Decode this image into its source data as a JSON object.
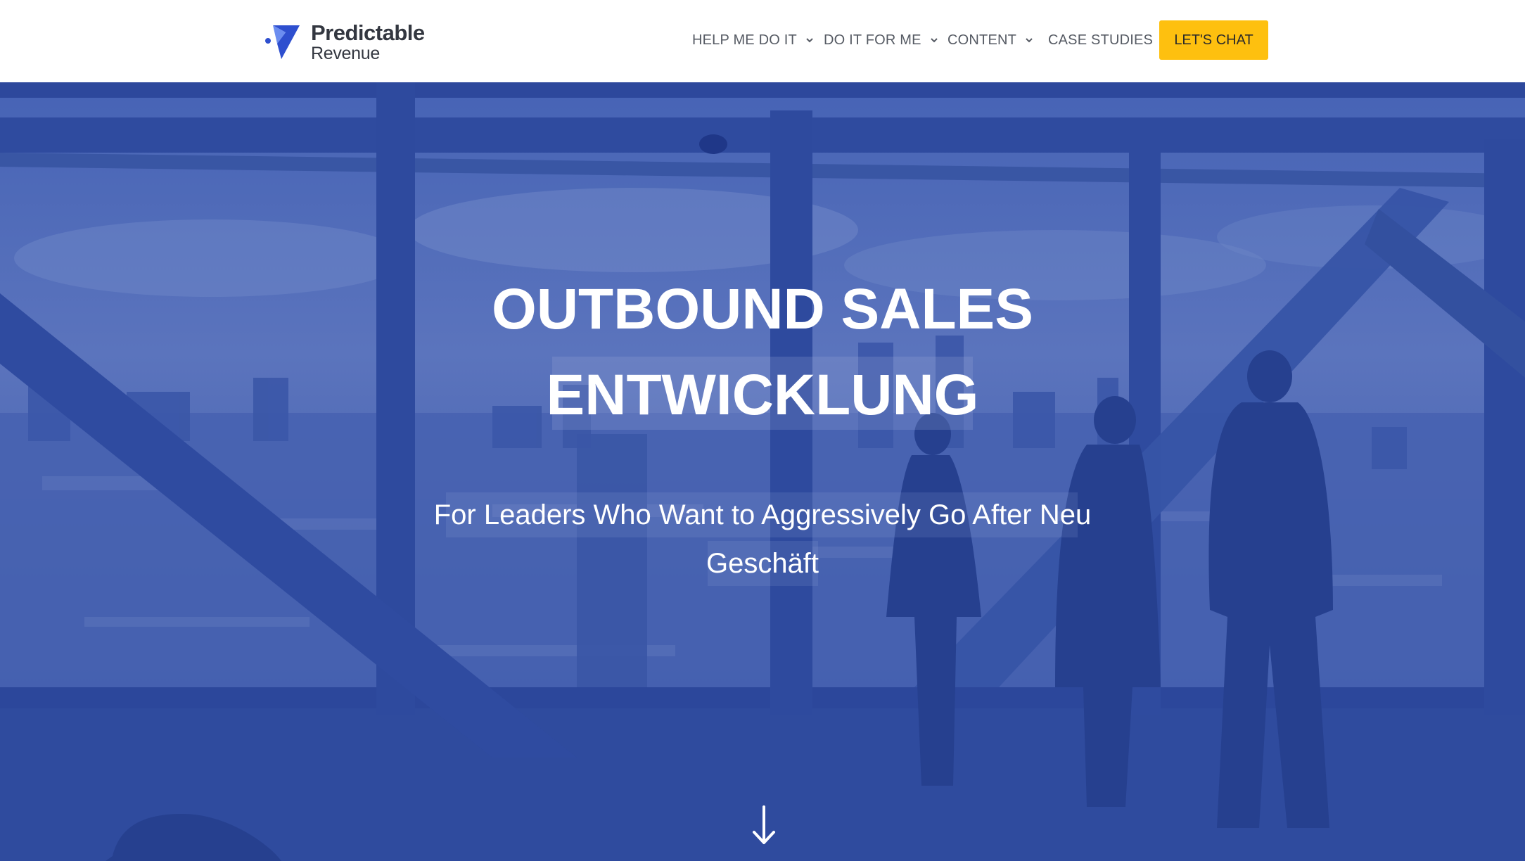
{
  "header": {
    "logo": {
      "name_line1": "Predictable",
      "name_line2": "Revenue"
    },
    "nav": [
      {
        "label": "HELP ME DO IT",
        "has_dropdown": true
      },
      {
        "label": "DO IT FOR ME",
        "has_dropdown": true
      },
      {
        "label": "CONTENT",
        "has_dropdown": true
      },
      {
        "label": "CASE STUDIES",
        "has_dropdown": false
      }
    ],
    "cta_label": "LET'S CHAT"
  },
  "hero": {
    "title_line1": "OUTBOUND SALES",
    "title_line2": "ENTWICKLUNG",
    "subtitle_line1": "For Leaders Who Want to Aggressively Go After Neu",
    "subtitle_line2": "Geschäft",
    "scroll_icon": "arrow-down-icon",
    "overlay_color": "#3553a8"
  },
  "colors": {
    "accent": "#fec00f",
    "logo_blue": "#2e4fcf",
    "nav_text": "#555a63"
  }
}
